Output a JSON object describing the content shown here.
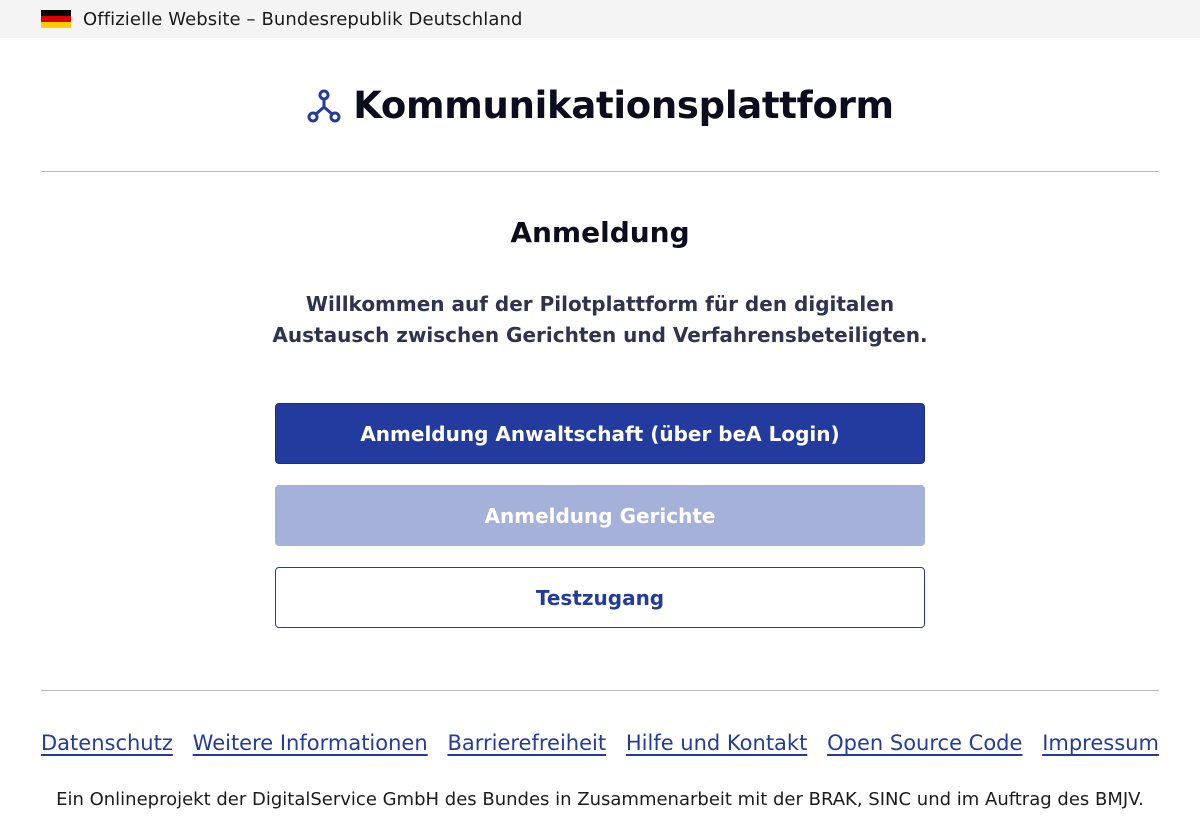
{
  "gov_bar": {
    "text": "Offizielle Website – Bundesrepublik Deutschland",
    "flag_colors": [
      "#000000",
      "#dd0000",
      "#ffcc00"
    ]
  },
  "header": {
    "title": "Kommunikationsplattform",
    "logo_icon": "network-nodes-icon",
    "accent_color": "#233b9f"
  },
  "main": {
    "heading": "Anmeldung",
    "welcome_line1": "Willkommen auf der Pilotplattform für den digitalen",
    "welcome_line2": "Austausch zwischen Gerichten und Verfahrensbeteiligten.",
    "buttons": {
      "lawyer_login": "Anmeldung Anwaltschaft (über beA Login)",
      "court_login": "Anmeldung Gerichte",
      "test_access": "Testzugang"
    }
  },
  "footer": {
    "links": [
      "Datenschutz",
      "Weitere Informationen",
      "Barrierefreiheit",
      "Hilfe und Kontakt",
      "Open Source Code",
      "Impressum"
    ],
    "note": "Ein Onlineprojekt der DigitalService GmbH des Bundes in Zusammenarbeit mit der BRAK, SINC und im Auftrag des BMJV."
  },
  "colors": {
    "primary": "#233b9f",
    "disabled": "#a6b1d9",
    "text": "#0b0c1c"
  }
}
